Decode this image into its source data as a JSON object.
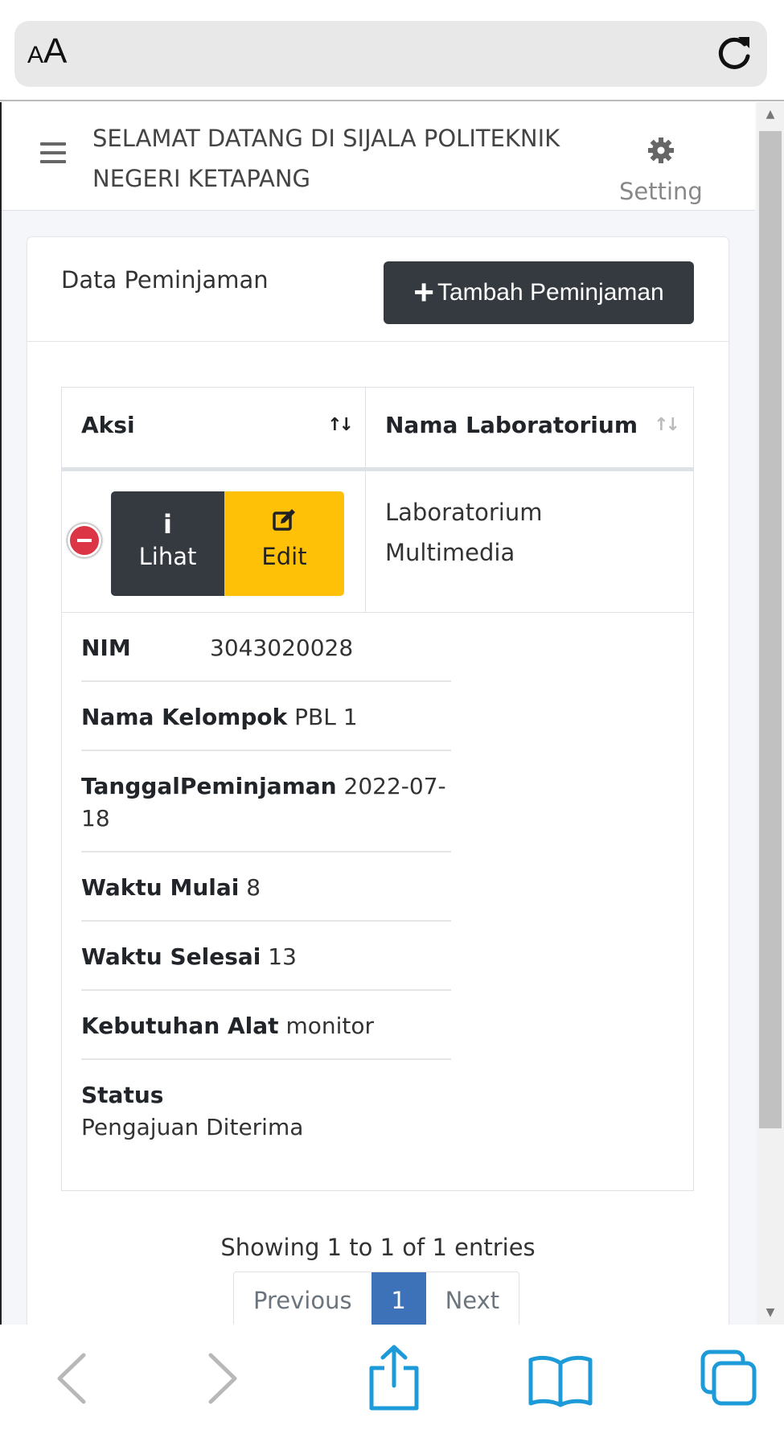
{
  "browser": {
    "aa_small": "A",
    "aa_big": "A",
    "reload_icon": "reload-icon"
  },
  "navbar": {
    "title_line1": "SELAMAT DATANG DI SIJALA POLITEKNIK",
    "title_line2": "NEGERI KETAPANG",
    "setting_label": "Setting"
  },
  "card": {
    "title": "Data Peminjaman",
    "add_button": "Tambah Peminjaman"
  },
  "table": {
    "columns": [
      "Aksi",
      "Nama Laboratorium"
    ],
    "row": {
      "lihat_label": "Lihat",
      "edit_label": "Edit",
      "lab_line1": "Laboratorium",
      "lab_line2": "Multimedia"
    },
    "details": {
      "nim_label": "NIM",
      "nim_value": "3043020028",
      "kelompok_label": "Nama Kelompok",
      "kelompok_value": "PBL 1",
      "tanggal_label": "TanggalPeminjaman",
      "tanggal_value": "2022-07-18",
      "mulai_label": "Waktu Mulai",
      "mulai_value": "8",
      "selesai_label": "Waktu Selesai",
      "selesai_value": "13",
      "alat_label": "Kebutuhan Alat",
      "alat_value": "monitor",
      "status_label": "Status",
      "status_value": "Pengajuan Diterima"
    }
  },
  "pagination": {
    "info": "Showing 1 to 1 of 1 entries",
    "previous": "Previous",
    "current": "1",
    "next": "Next"
  },
  "colors": {
    "dark": "#343a40",
    "warning": "#ffc107",
    "danger": "#dc3545",
    "primary": "#3e72b8",
    "ios_blue": "#1c9bd8"
  }
}
